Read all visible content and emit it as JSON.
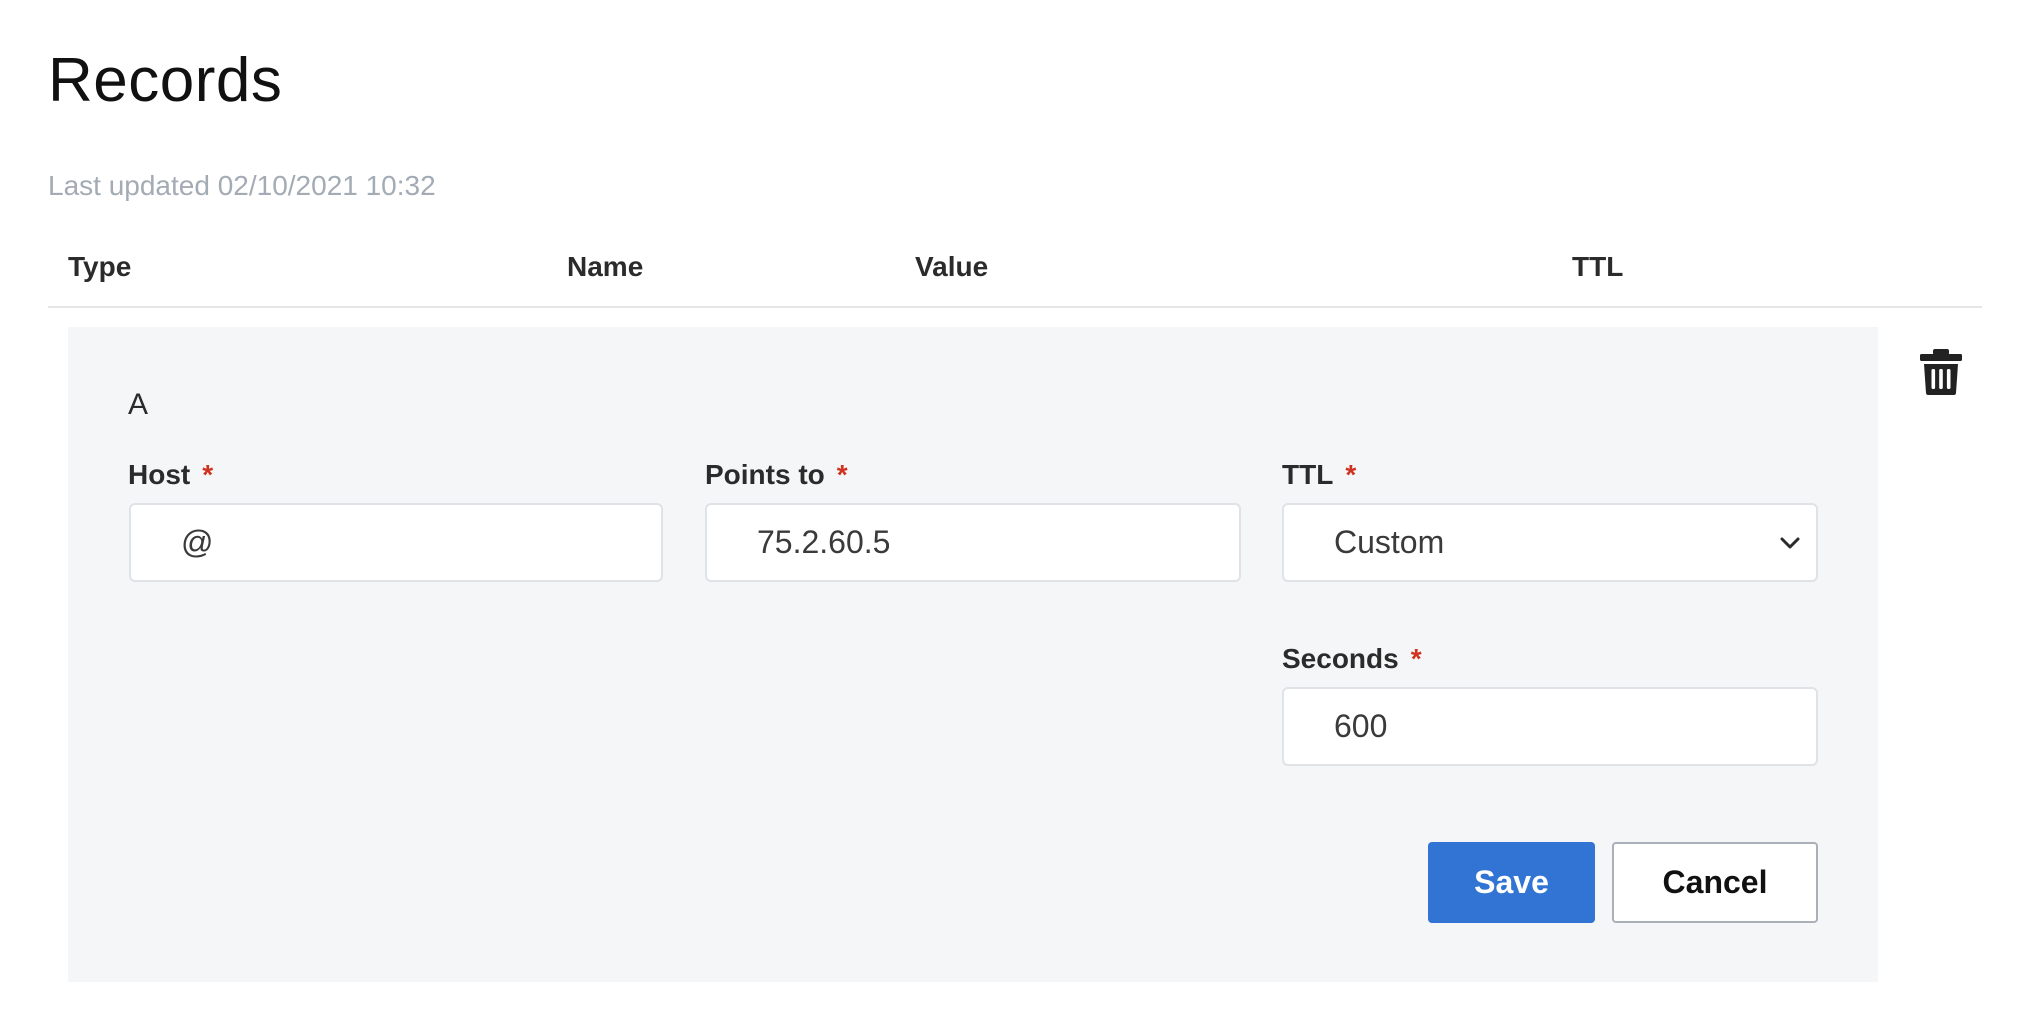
{
  "page": {
    "title": "Records",
    "last_updated": "Last updated 02/10/2021 10:32"
  },
  "table": {
    "columns": [
      "Type",
      "Name",
      "Value",
      "TTL"
    ]
  },
  "edit_form": {
    "record_type": "A",
    "host": {
      "label": "Host",
      "required_mark": "*",
      "value": "@"
    },
    "points_to": {
      "label": "Points to",
      "required_mark": "*",
      "value": "75.2.60.5"
    },
    "ttl": {
      "label": "TTL",
      "required_mark": "*",
      "selected": "Custom"
    },
    "seconds": {
      "label": "Seconds",
      "required_mark": "*",
      "value": "600"
    },
    "save_label": "Save",
    "cancel_label": "Cancel"
  },
  "icons": {
    "delete": "trash-icon",
    "ttl_dropdown": "chevron-down-icon"
  },
  "colors": {
    "primary": "#3174d4",
    "required": "#d0321f",
    "muted_text": "#a3abb4",
    "panel_bg": "#f5f6f7"
  }
}
